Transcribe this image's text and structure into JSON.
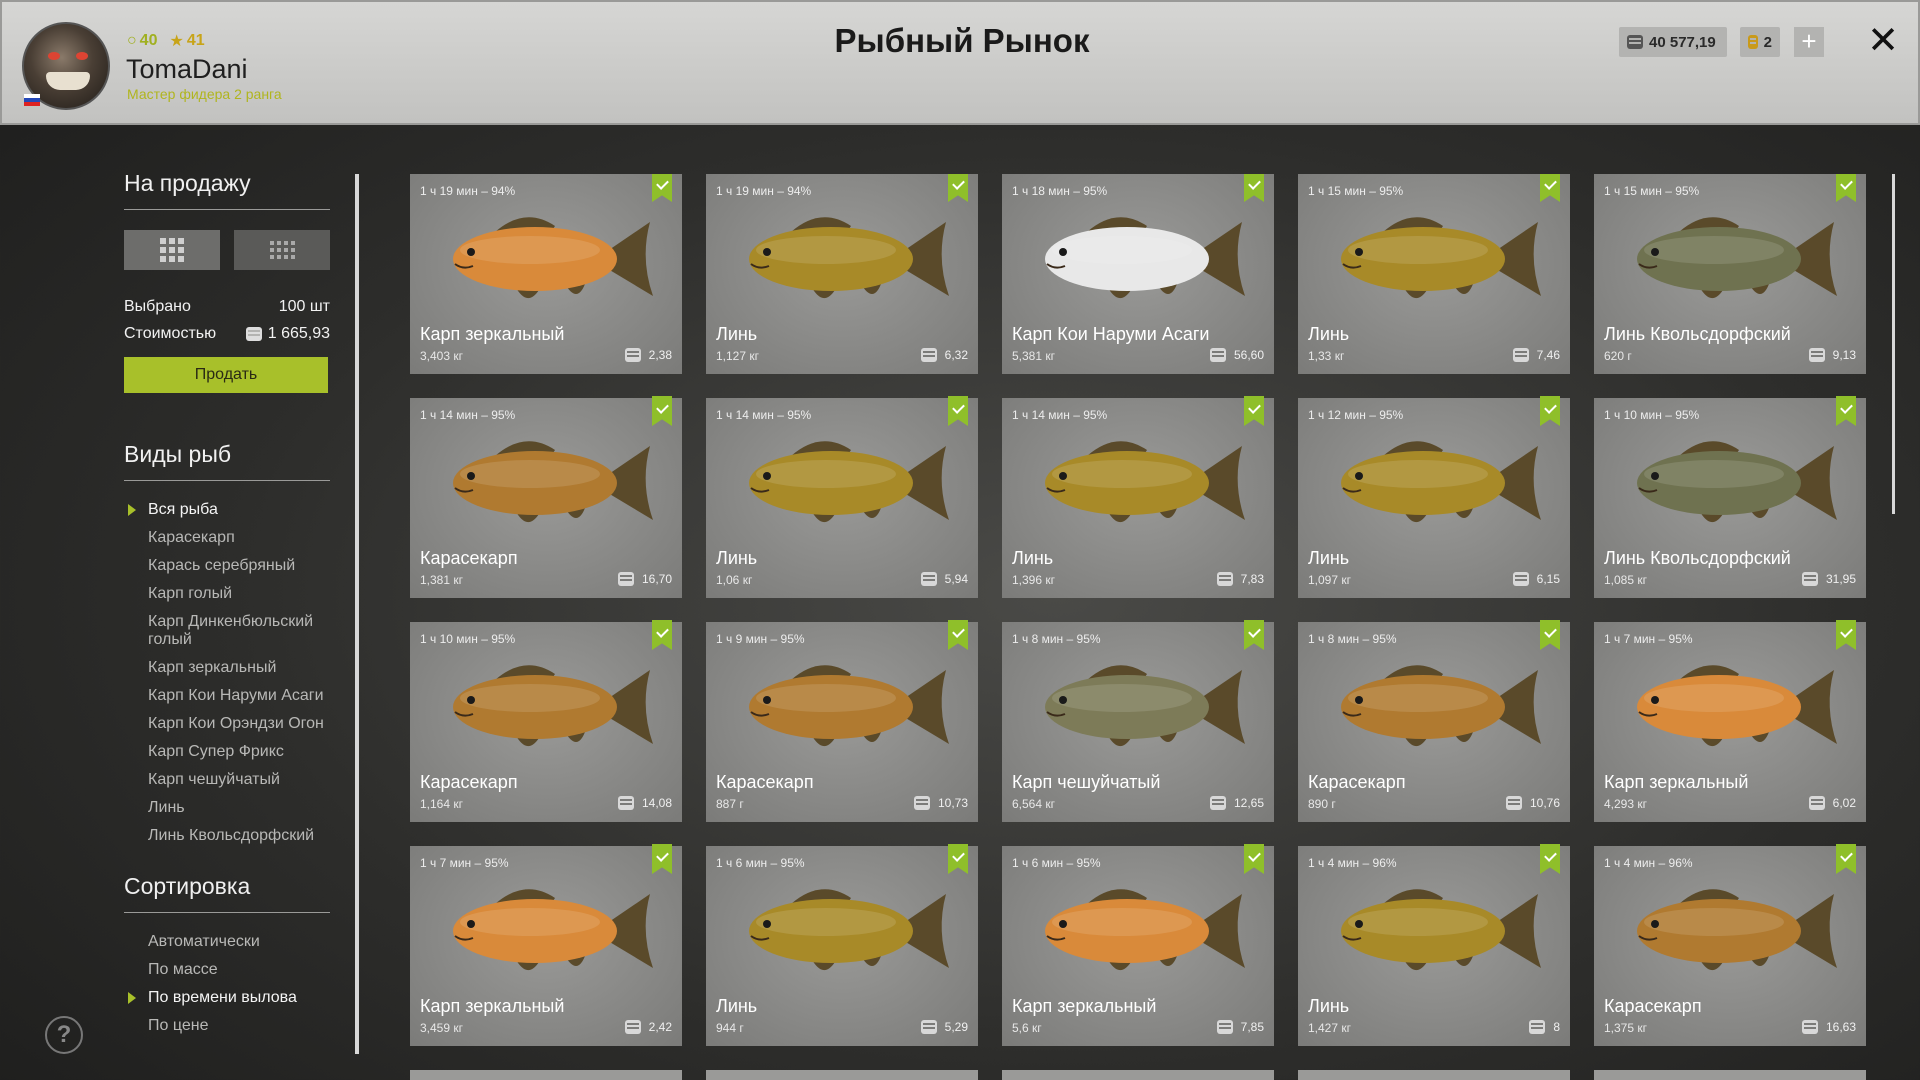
{
  "header": {
    "title": "Рыбный Рынок",
    "player": {
      "name": "TomaDani",
      "rank": "Мастер фидера 2 ранга",
      "xp": "40",
      "stars": "41"
    },
    "silver": "40 577,19",
    "gold": "2",
    "plus_label": "+",
    "close_label": "✕"
  },
  "sidebar": {
    "for_sale_title": "На продажу",
    "selected_label": "Выбрано",
    "selected_value": "100 шт",
    "cost_label": "Стоимостью",
    "cost_value": "1 665,93",
    "sell_button": "Продать",
    "species_title": "Виды рыб",
    "species": [
      "Вся рыба",
      "Карасекарп",
      "Карась серебряный",
      "Карп голый",
      "Карп Динкенбюльский голый",
      "Карп зеркальный",
      "Карп Кои Наруми Асаги",
      "Карп Кои Орэндзи Огон",
      "Карп Супер Фрикс",
      "Карп чешуйчатый",
      "Линь",
      "Линь Квольсдорфский"
    ],
    "sort_title": "Сортировка",
    "sort_options": [
      "Автоматически",
      "По массе",
      "По времени вылова",
      "По цене"
    ],
    "help": "?"
  },
  "cards": [
    {
      "time": "1 ч 19 мин – 94%",
      "name": "Карп зеркальный",
      "weight": "3,403 кг",
      "price": "2,38",
      "color": "#d98a3a"
    },
    {
      "time": "1 ч 19 мин – 94%",
      "name": "Линь",
      "weight": "1,127 кг",
      "price": "6,32",
      "color": "#a88a28"
    },
    {
      "time": "1 ч 18 мин – 95%",
      "name": "Карп Кои Наруми Асаги",
      "weight": "5,381 кг",
      "price": "56,60",
      "color": "#e8e8e8"
    },
    {
      "time": "1 ч 15 мин – 95%",
      "name": "Линь",
      "weight": "1,33 кг",
      "price": "7,46",
      "color": "#a88a28"
    },
    {
      "time": "1 ч 15 мин – 95%",
      "name": "Линь Квольсдорфский",
      "weight": "620 г",
      "price": "9,13",
      "color": "#6f7250"
    },
    {
      "time": "1 ч 14 мин – 95%",
      "name": "Карасекарп",
      "weight": "1,381 кг",
      "price": "16,70",
      "color": "#b07a30"
    },
    {
      "time": "1 ч 14 мин – 95%",
      "name": "Линь",
      "weight": "1,06 кг",
      "price": "5,94",
      "color": "#a88a28"
    },
    {
      "time": "1 ч 14 мин – 95%",
      "name": "Линь",
      "weight": "1,396 кг",
      "price": "7,83",
      "color": "#a88a28"
    },
    {
      "time": "1 ч 12 мин – 95%",
      "name": "Линь",
      "weight": "1,097 кг",
      "price": "6,15",
      "color": "#a88a28"
    },
    {
      "time": "1 ч 10 мин – 95%",
      "name": "Линь Квольсдорфский",
      "weight": "1,085 кг",
      "price": "31,95",
      "color": "#6f7250"
    },
    {
      "time": "1 ч 10 мин – 95%",
      "name": "Карасекарп",
      "weight": "1,164 кг",
      "price": "14,08",
      "color": "#b07a30"
    },
    {
      "time": "1 ч 9 мин – 95%",
      "name": "Карасекарп",
      "weight": "887 г",
      "price": "10,73",
      "color": "#b07a30"
    },
    {
      "time": "1 ч 8 мин – 95%",
      "name": "Карп чешуйчатый",
      "weight": "6,564 кг",
      "price": "12,65",
      "color": "#7d7b58"
    },
    {
      "time": "1 ч 8 мин – 95%",
      "name": "Карасекарп",
      "weight": "890 г",
      "price": "10,76",
      "color": "#b07a30"
    },
    {
      "time": "1 ч 7 мин – 95%",
      "name": "Карп зеркальный",
      "weight": "4,293 кг",
      "price": "6,02",
      "color": "#d98a3a"
    },
    {
      "time": "1 ч 7 мин – 95%",
      "name": "Карп зеркальный",
      "weight": "3,459 кг",
      "price": "2,42",
      "color": "#d98a3a"
    },
    {
      "time": "1 ч 6 мин – 95%",
      "name": "Линь",
      "weight": "944 г",
      "price": "5,29",
      "color": "#a88a28"
    },
    {
      "time": "1 ч 6 мин – 95%",
      "name": "Карп зеркальный",
      "weight": "5,6 кг",
      "price": "7,85",
      "color": "#d98a3a"
    },
    {
      "time": "1 ч 4 мин – 96%",
      "name": "Линь",
      "weight": "1,427 кг",
      "price": "8",
      "color": "#a88a28"
    },
    {
      "time": "1 ч 4 мин – 96%",
      "name": "Карасекарп",
      "weight": "1,375 кг",
      "price": "16,63",
      "color": "#b07a30"
    }
  ]
}
